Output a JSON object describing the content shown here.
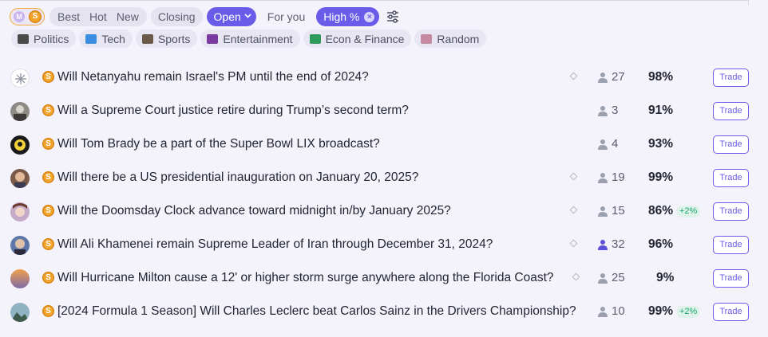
{
  "filters": {
    "mode_m": "M",
    "mode_s": "S",
    "sort_options": [
      "Best",
      "Hot",
      "New"
    ],
    "closing": "Closing",
    "status": "Open",
    "for_you": "For you",
    "prob_filter": "High %"
  },
  "categories": [
    {
      "label": "Politics",
      "icon": "clapperboard-icon",
      "color": "#4a4a4a"
    },
    {
      "label": "Tech",
      "icon": "computer-icon",
      "color": "#3b8de0"
    },
    {
      "label": "Sports",
      "icon": "stadium-icon",
      "color": "#6b5a4a"
    },
    {
      "label": "Entertainment",
      "icon": "film-icon",
      "color": "#7a3aa0"
    },
    {
      "label": "Econ & Finance",
      "icon": "money-icon",
      "color": "#2e9b5a"
    },
    {
      "label": "Random",
      "icon": "dice-icon",
      "color": "#c58aa0"
    }
  ],
  "markets": [
    {
      "question": "Will Netanyahu remain Israel's PM until the end of 2024?",
      "traders": "27",
      "prob": "98%",
      "change": "",
      "bookmark": true,
      "trade": "Trade"
    },
    {
      "question": "Will a Supreme Court justice retire during Trump’s second term?",
      "traders": "3",
      "prob": "91%",
      "change": "",
      "bookmark": false,
      "trade": "Trade"
    },
    {
      "question": "Will Tom Brady be a part of the Super Bowl LIX broadcast?",
      "traders": "4",
      "prob": "93%",
      "change": "",
      "bookmark": false,
      "trade": "Trade"
    },
    {
      "question": "Will there be a US presidential inauguration on January 20, 2025?",
      "traders": "19",
      "prob": "99%",
      "change": "",
      "bookmark": true,
      "trade": "Trade"
    },
    {
      "question": "Will the Doomsday Clock advance toward midnight in/by January 2025?",
      "traders": "15",
      "prob": "86%",
      "change": "+2%",
      "bookmark": true,
      "trade": "Trade"
    },
    {
      "question": "Will Ali Khamenei remain Supreme Leader of Iran through December 31, 2024?",
      "traders": "32",
      "prob": "96%",
      "change": "",
      "bookmark": true,
      "trade": "Trade"
    },
    {
      "question": "Will Hurricane Milton cause a 12' or higher storm surge anywhere along the Florida Coast?",
      "traders": "25",
      "prob": "9%",
      "change": "",
      "bookmark": true,
      "trade": "Trade"
    },
    {
      "question": "[2024 Formula 1 Season] Will Charles Leclerc beat Carlos Sainz in the Drivers Championship?",
      "traders": "10",
      "prob": "99%",
      "change": "+2%",
      "bookmark": false,
      "trade": "Trade"
    }
  ],
  "colors": {
    "accent": "#6a5ce8",
    "coin": "#f2a52a",
    "positive": "#17a673"
  }
}
